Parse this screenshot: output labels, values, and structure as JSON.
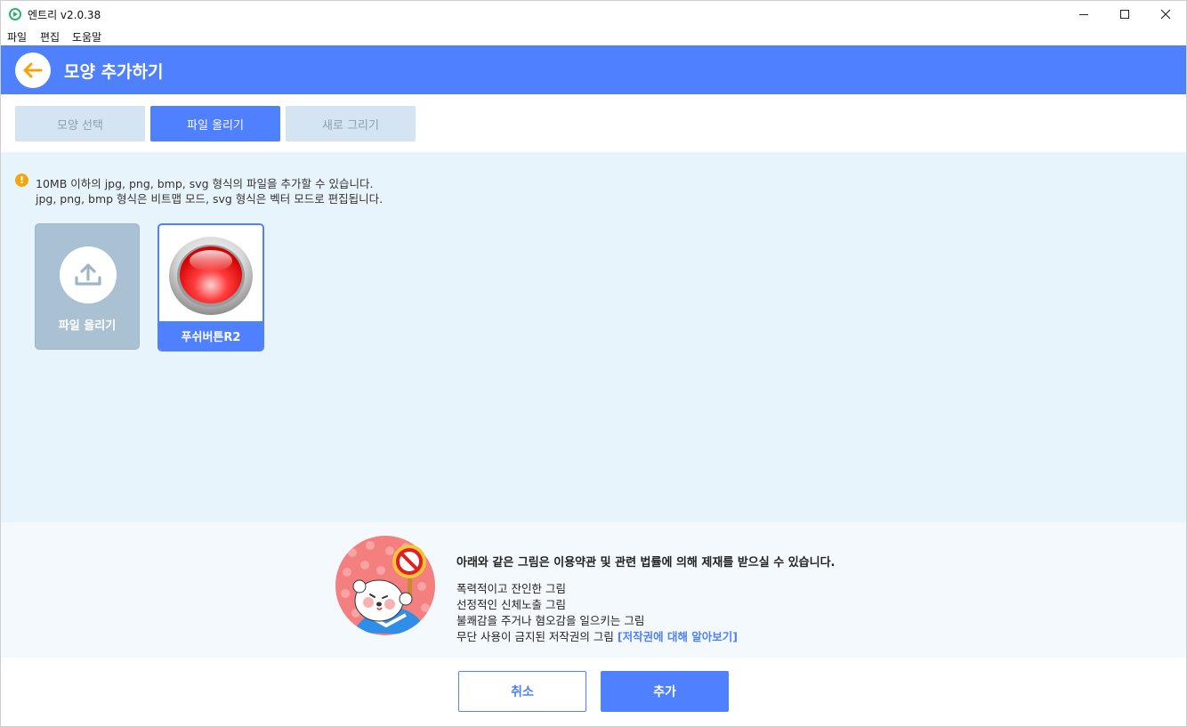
{
  "window": {
    "title": "엔트리 v2.0.38",
    "icon": "entry-logo-icon",
    "controls": [
      "minimize",
      "maximize",
      "close"
    ]
  },
  "menu": {
    "items": [
      {
        "label": "파일"
      },
      {
        "label": "편집"
      },
      {
        "label": "도움말"
      }
    ]
  },
  "header": {
    "title": "모양 추가하기",
    "back_icon": "arrow-left-icon",
    "color": "#4f80ff",
    "back_arrow_color": "#f5a20a"
  },
  "tabs": [
    {
      "label": "모양 선택",
      "active": false
    },
    {
      "label": "파일 올리기",
      "active": true
    },
    {
      "label": "새로 그리기",
      "active": false
    }
  ],
  "notice": {
    "icon": "warning-icon",
    "icon_glyph": "!",
    "lines": [
      "10MB 이하의 jpg, png, bmp, svg 형식의 파일을 추가할 수 있습니다.",
      "jpg, png, bmp 형식은 비트맵 모드, svg 형식은 벡터 모드로 편집됩니다."
    ]
  },
  "upload_card": {
    "label": "파일 올리기",
    "icon": "upload-icon"
  },
  "uploaded_items": [
    {
      "label": "푸쉬버튼R2",
      "selected": true,
      "thumbnail": "red-push-button-image"
    }
  ],
  "warning": {
    "title": "아래와 같은 그림은 이용약관 및 관련 법률에 의해 제재를 받으실 수 있습니다.",
    "items": [
      "폭력적이고 잔인한 그림",
      "선정적인 신체노출 그림",
      "불쾌감을 주거나 혐오감을 일으키는 그림"
    ],
    "last_item": "무단 사용이 금지된 저작권의 그림",
    "link": "[저작권에 대해 알아보기]",
    "illustration": "mascot-holding-prohibition-sign"
  },
  "buttons": {
    "cancel": "취소",
    "add": "추가"
  }
}
